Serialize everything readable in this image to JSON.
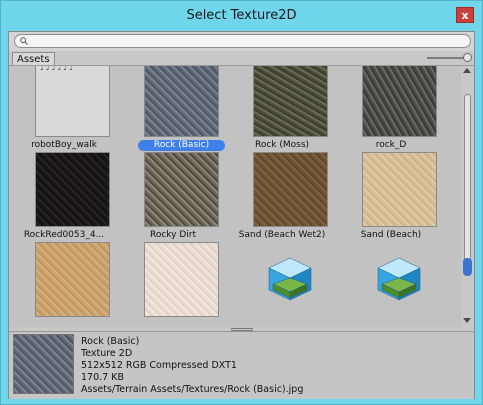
{
  "window": {
    "title": "Select Texture2D",
    "close_label": "x"
  },
  "search": {
    "placeholder": ""
  },
  "tabs": {
    "assets": "Assets"
  },
  "assets": [
    {
      "label": "robotBoy_walk",
      "selected": false,
      "kind": "sprite-sheet"
    },
    {
      "label": "Rock (Basic)",
      "selected": true,
      "kind": "rock-basic"
    },
    {
      "label": "Rock (Moss)",
      "selected": false,
      "kind": "rock-moss"
    },
    {
      "label": "rock_D",
      "selected": false,
      "kind": "rock-d"
    },
    {
      "label": "RockRed0053_4...",
      "selected": false,
      "kind": "rock-red"
    },
    {
      "label": "Rocky Dirt",
      "selected": false,
      "kind": "rocky-dirt"
    },
    {
      "label": "Sand (Beach Wet2)",
      "selected": false,
      "kind": "sand-wet"
    },
    {
      "label": "Sand (Beach)",
      "selected": false,
      "kind": "sand-beach"
    },
    {
      "label": "",
      "selected": false,
      "kind": "sand-dry"
    },
    {
      "label": "",
      "selected": false,
      "kind": "snow"
    },
    {
      "label": "",
      "selected": false,
      "kind": "terrain-asset-icon"
    },
    {
      "label": "",
      "selected": false,
      "kind": "terrain-asset-icon"
    }
  ],
  "preview": {
    "name": "Rock (Basic)",
    "type": "Texture 2D",
    "format": "512x512  RGB Compressed DXT1",
    "size": "170.7 KB",
    "path": "Assets/Terrain Assets/Textures/Rock (Basic).jpg"
  },
  "colors": {
    "accent": "#3f7fe8",
    "titlebar": "#6fd6ec",
    "close": "#c8403a"
  }
}
